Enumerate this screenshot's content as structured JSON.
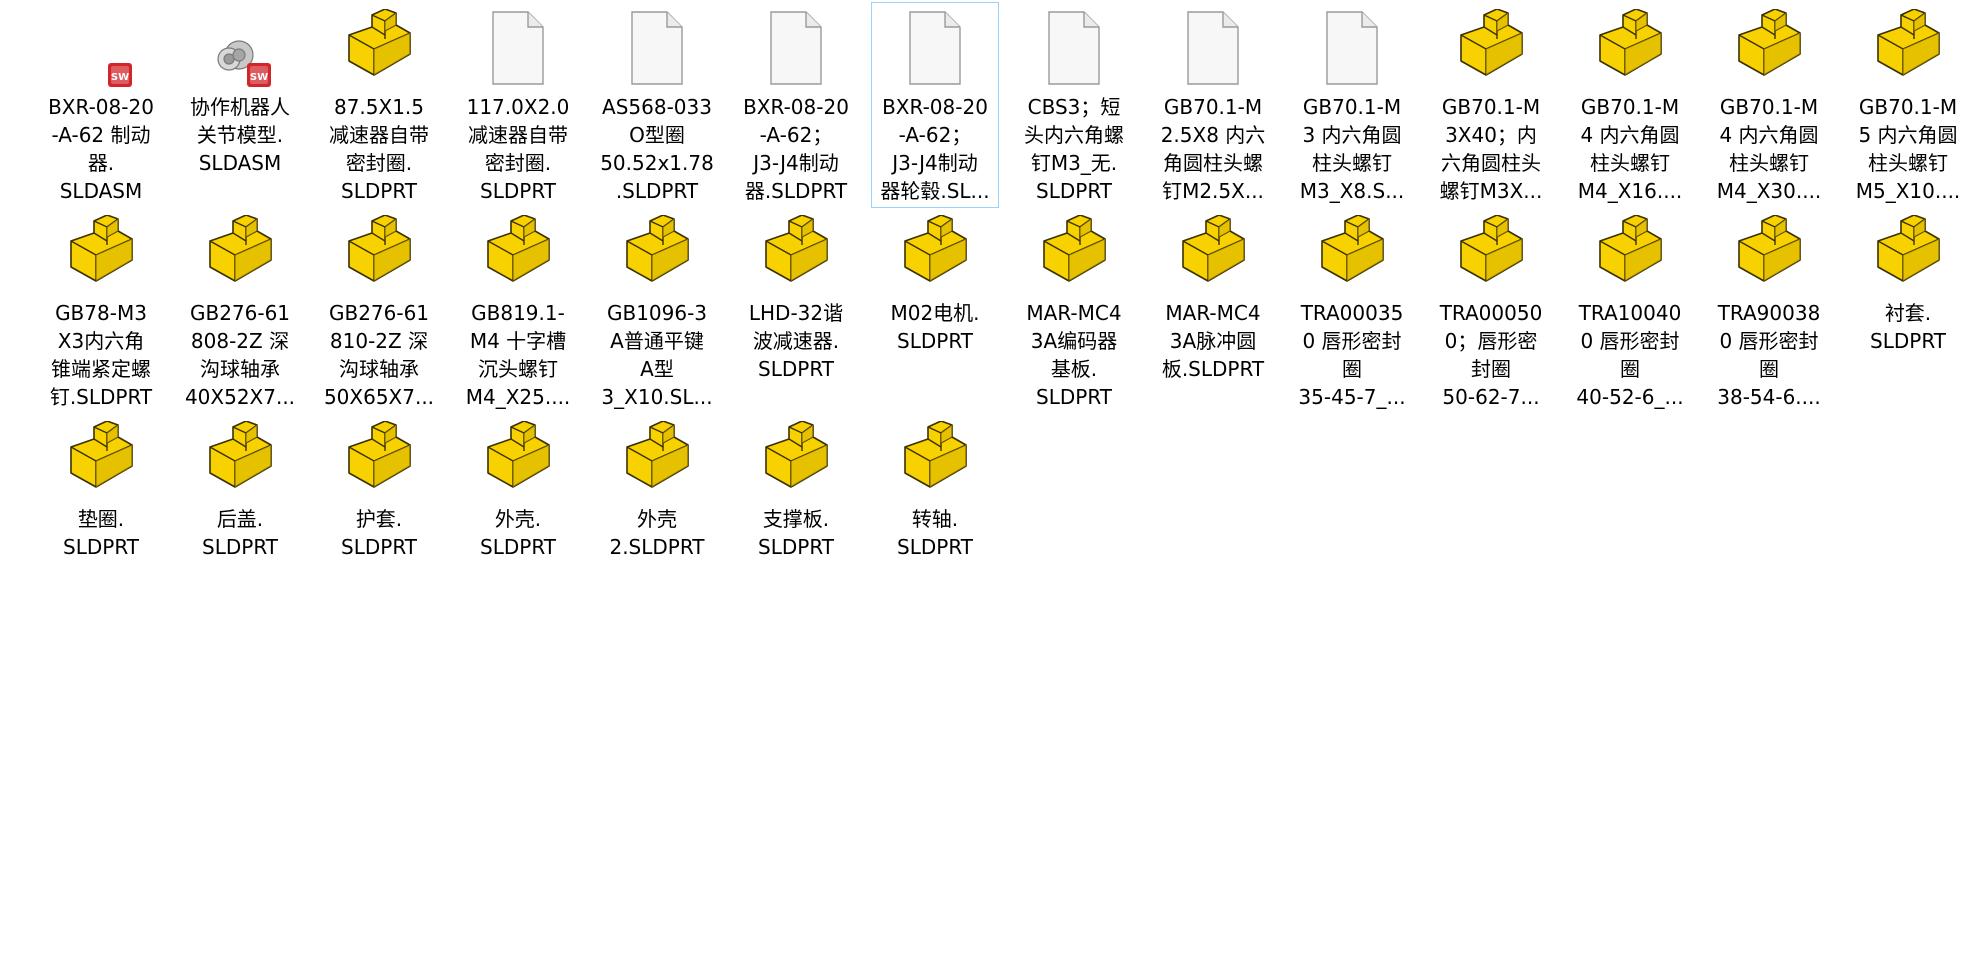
{
  "window": {
    "view": "large-icons"
  },
  "colors": {
    "selection_border": "#99d1ff",
    "part_icon_fill": "#f7d100",
    "part_icon_stroke": "#3a3000",
    "doc_icon_fill": "#f7f7f7",
    "doc_icon_stroke": "#9a9a9a",
    "sw_badge": "#d2262b"
  },
  "files": [
    {
      "icon": "solidworks-assembly-icon",
      "label": "BXR-08-20\n-A-62 制动\n器.\nSLDASM"
    },
    {
      "icon": "solidworks-assembly-icon-gear",
      "label": "协作机器人\n关节模型.\nSLDASM"
    },
    {
      "icon": "part-icon",
      "label": "87.5X1.5\n减速器自带\n密封圈.\nSLDPRT"
    },
    {
      "icon": "document-icon",
      "label": "117.0X2.0\n减速器自带\n密封圈.\nSLDPRT"
    },
    {
      "icon": "document-icon",
      "label": "AS568-033\nO型圈\n50.52x1.78\n.SLDPRT"
    },
    {
      "icon": "document-icon",
      "label": "BXR-08-20\n-A-62；\nJ3-J4制动\n器.SLDPRT"
    },
    {
      "icon": "document-icon",
      "label": "BXR-08-20\n-A-62；\nJ3-J4制动\n器轮毂.SL...",
      "selected": true
    },
    {
      "icon": "document-icon",
      "label": "CBS3；短\n头内六角螺\n钉M3_无.\nSLDPRT"
    },
    {
      "icon": "document-icon",
      "label": "GB70.1-M\n2.5X8 内六\n角圆柱头螺\n钉M2.5X..."
    },
    {
      "icon": "document-icon",
      "label": "GB70.1-M\n3 内六角圆\n柱头螺钉\nM3_X8.S..."
    },
    {
      "icon": "part-icon",
      "label": "GB70.1-M\n3X40；内\n六角圆柱头\n螺钉M3X..."
    },
    {
      "icon": "part-icon",
      "label": "GB70.1-M\n4 内六角圆\n柱头螺钉\nM4_X16...."
    },
    {
      "icon": "part-icon",
      "label": "GB70.1-M\n4 内六角圆\n柱头螺钉\nM4_X30...."
    },
    {
      "icon": "part-icon",
      "label": "GB70.1-M\n5 内六角圆\n柱头螺钉\nM5_X10...."
    },
    {
      "icon": "part-icon",
      "label": "GB78-M3\nX3内六角\n锥端紧定螺\n钉.SLDPRT"
    },
    {
      "icon": "part-icon",
      "label": "GB276-61\n808-2Z 深\n沟球轴承\n40X52X7..."
    },
    {
      "icon": "part-icon",
      "label": "GB276-61\n810-2Z 深\n沟球轴承\n50X65X7..."
    },
    {
      "icon": "part-icon",
      "label": "GB819.1-\nM4 十字槽\n沉头螺钉\nM4_X25...."
    },
    {
      "icon": "part-icon",
      "label": "GB1096-3\nA普通平键\nA型\n3_X10.SL..."
    },
    {
      "icon": "part-icon",
      "label": "LHD-32谐\n波减速器.\nSLDPRT"
    },
    {
      "icon": "part-icon",
      "label": "M02电机.\nSLDPRT"
    },
    {
      "icon": "part-icon",
      "label": "MAR-MC4\n3A编码器\n基板.\nSLDPRT"
    },
    {
      "icon": "part-icon",
      "label": "MAR-MC4\n3A脉冲圆\n板.SLDPRT"
    },
    {
      "icon": "part-icon",
      "label": "TRA00035\n0 唇形密封\n圈\n35-45-7_..."
    },
    {
      "icon": "part-icon",
      "label": "TRA00050\n0；唇形密\n封圈\n50-62-7..."
    },
    {
      "icon": "part-icon",
      "label": "TRA10040\n0 唇形密封\n圈\n40-52-6_..."
    },
    {
      "icon": "part-icon",
      "label": "TRA90038\n0 唇形密封\n圈\n38-54-6...."
    },
    {
      "icon": "part-icon",
      "label": "衬套.\nSLDPRT"
    },
    {
      "icon": "part-icon",
      "label": "垫圈.\nSLDPRT"
    },
    {
      "icon": "part-icon",
      "label": "后盖.\nSLDPRT"
    },
    {
      "icon": "part-icon",
      "label": "护套.\nSLDPRT"
    },
    {
      "icon": "part-icon",
      "label": "外壳.\nSLDPRT"
    },
    {
      "icon": "part-icon",
      "label": "外壳\n2.SLDPRT"
    },
    {
      "icon": "part-icon",
      "label": "支撑板.\nSLDPRT"
    },
    {
      "icon": "part-icon",
      "label": "转轴.\nSLDPRT"
    }
  ]
}
